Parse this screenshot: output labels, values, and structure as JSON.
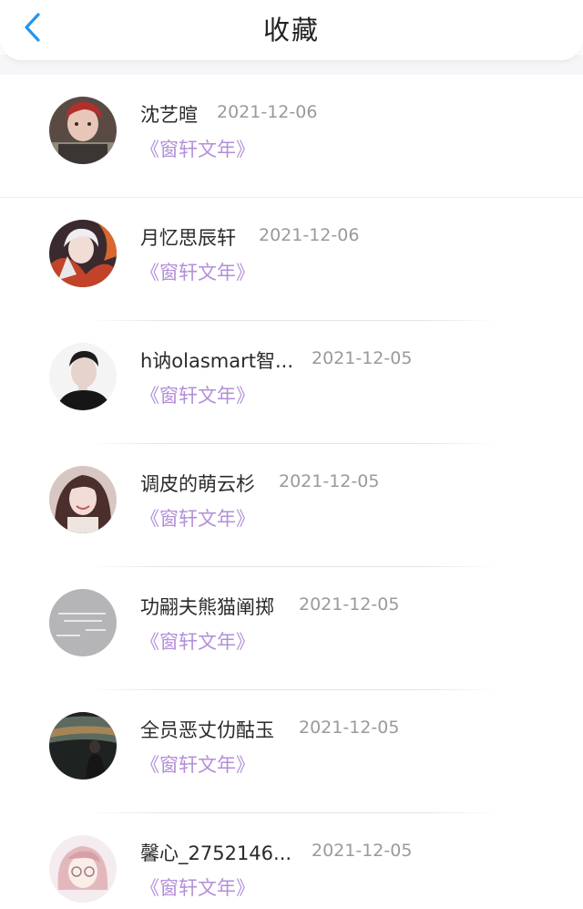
{
  "header": {
    "title": "收藏",
    "back_icon": "chevron-left-icon",
    "back_color": "#2196f3"
  },
  "favorites": [
    {
      "user": "沈艺暄",
      "date": "2021-12-06",
      "work": "《窗轩文年》",
      "avatar": "portrait-red-hair"
    },
    {
      "user": "月忆思辰轩",
      "date": "2021-12-06",
      "work": "《窗轩文年》",
      "avatar": "anime-white-hair-fire"
    },
    {
      "user": "h讷olasmart智...",
      "date": "2021-12-05",
      "work": "《窗轩文年》",
      "avatar": "portrait-dark-suit"
    },
    {
      "user": "调皮的萌云杉",
      "date": "2021-12-05",
      "work": "《窗轩文年》",
      "avatar": "portrait-girl-smile"
    },
    {
      "user": "功翤夫熊猫阐掷",
      "date": "2021-12-05",
      "work": "《窗轩文年》",
      "avatar": "gray-text-image"
    },
    {
      "user": "全员恶丈仂酤玉",
      "date": "2021-12-05",
      "work": "《窗轩文年》",
      "avatar": "landscape-dusk-sky"
    },
    {
      "user": "馨心_2752146...",
      "date": "2021-12-05",
      "work": "《窗轩文年》",
      "avatar": "anime-girl-pink"
    }
  ],
  "colors": {
    "work_link": "#b38fd9",
    "date_text": "#9a9a9a",
    "name_text": "#2a2a2a"
  }
}
